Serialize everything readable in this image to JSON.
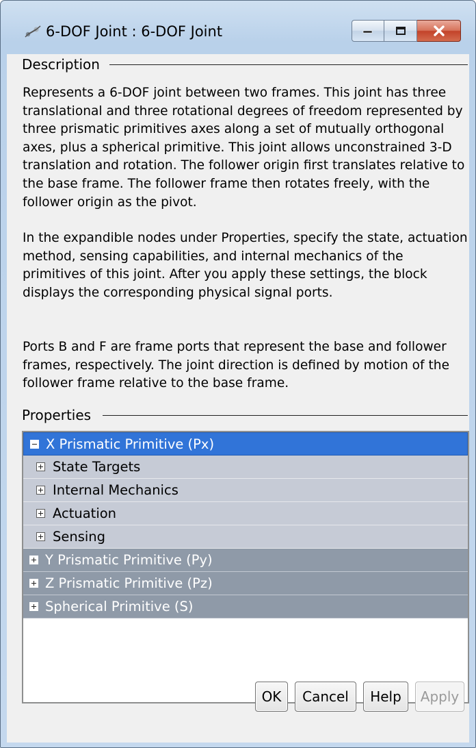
{
  "window": {
    "title": "6-DOF Joint : 6-DOF Joint",
    "icon": "joint-block-icon",
    "controls": [
      "minimize-icon",
      "maximize-icon",
      "close-icon"
    ]
  },
  "description": {
    "label": "Description",
    "paragraphs": [
      "Represents a 6-DOF joint between two frames. This joint has three translational and three rotational degrees of freedom represented by three prismatic primitives axes along a set of mutually orthogonal axes, plus a spherical primitive. This joint allows unconstrained 3-D translation and rotation. The follower origin first translates relative to the base frame. The follower frame then rotates freely, with the follower origin as the pivot.",
      "In the expandible nodes under Properties, specify the state, actuation method, sensing capabilities, and internal mechanics of the primitives of this joint. After you apply these settings, the block displays the corresponding physical signal ports.",
      "Ports B and F are frame ports that represent the base and follower frames, respectively. The joint direction is defined by motion of the follower frame relative to the base frame."
    ]
  },
  "properties": {
    "label": "Properties",
    "tree": [
      {
        "label": "X Prismatic Primitive (Px)",
        "level": 0,
        "expanded": true,
        "selected": true
      },
      {
        "label": "State Targets",
        "level": 1,
        "expanded": false
      },
      {
        "label": "Internal Mechanics",
        "level": 1,
        "expanded": false
      },
      {
        "label": "Actuation",
        "level": 1,
        "expanded": false
      },
      {
        "label": "Sensing",
        "level": 1,
        "expanded": false
      },
      {
        "label": "Y Prismatic Primitive (Py)",
        "level": 0,
        "expanded": false
      },
      {
        "label": "Z Prismatic Primitive (Pz)",
        "level": 0,
        "expanded": false
      },
      {
        "label": "Spherical Primitive (S)",
        "level": 0,
        "expanded": false
      }
    ]
  },
  "buttons": {
    "ok": "OK",
    "cancel": "Cancel",
    "help": "Help",
    "apply": "Apply"
  },
  "colors": {
    "selection": "#3174d8",
    "parent_row": "#8f9aa8",
    "child_row": "#c6cbd6",
    "close_button": "#c3432a"
  }
}
